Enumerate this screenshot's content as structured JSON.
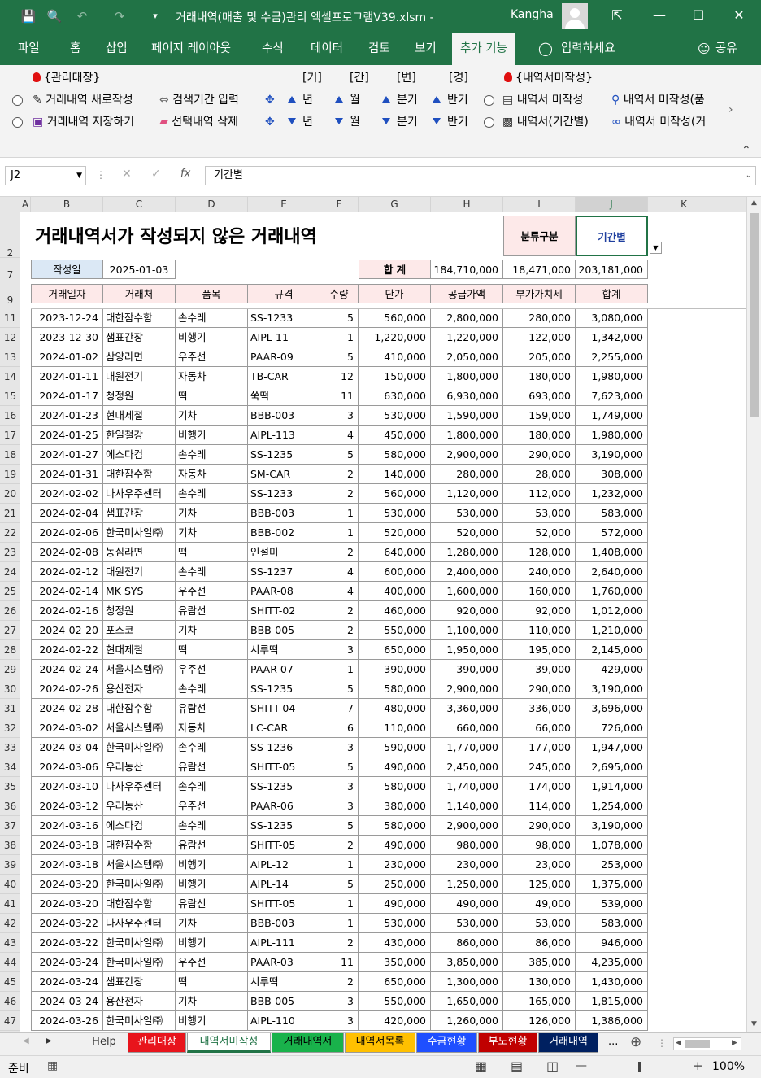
{
  "titlebar": {
    "doc_title": "거래내역(매출 및 수금)관리 엑셀프로그램V39.xlsm  -",
    "user": "Kangha"
  },
  "ribbon_tabs": [
    "파일",
    "홈",
    "삽입",
    "페이지 레이아웃",
    "수식",
    "데이터",
    "검토",
    "보기",
    "추가 기능"
  ],
  "tell_me": "입력하세요",
  "share": "공유",
  "ribbon": {
    "group1_label": "{관리대장}",
    "btn_new": "거래내역 새로작성",
    "btn_save": "거래내역 저장하기",
    "btn_period": "검색기간 입력",
    "btn_delete": "선택내역 삭제",
    "hdr_gi": "[기]",
    "hdr_gan": "[간]",
    "hdr_byeon": "[변]",
    "hdr_gyeong": "[경]",
    "year": "년",
    "month": "월",
    "quarter": "분기",
    "half": "반기",
    "group2_label": "{내역서미작성}",
    "btn_unwritten": "내역서 미작성",
    "btn_unwritten_period": "내역서(기간별)",
    "btn_unwritten_item": "내역서 미작성(품",
    "btn_unwritten_client": "내역서 미작성(거"
  },
  "formula_bar": {
    "name_box": "J2",
    "formula": "기간별"
  },
  "columns": [
    "A",
    "B",
    "C",
    "D",
    "E",
    "F",
    "G",
    "H",
    "I",
    "J",
    "K"
  ],
  "sheet": {
    "title": "거래내역서가 작성되지 않은 거래내역",
    "class_label": "분류구분",
    "class_value": "기간별",
    "date_label": "작성일",
    "date_value": "2025-01-03",
    "total_label": "합  계",
    "total_supply": "184,710,000",
    "total_vat": "18,471,000",
    "total_sum": "203,181,000",
    "headers": [
      "거래일자",
      "거래처",
      "품목",
      "규격",
      "수량",
      "단가",
      "공급가액",
      "부가가치세",
      "합계"
    ],
    "rows": [
      [
        "2023-12-24",
        "대한잠수함",
        "손수레",
        "SS-1233",
        "5",
        "560,000",
        "2,800,000",
        "280,000",
        "3,080,000"
      ],
      [
        "2023-12-30",
        "샘표간장",
        "비행기",
        "AIPL-11",
        "1",
        "1,220,000",
        "1,220,000",
        "122,000",
        "1,342,000"
      ],
      [
        "2024-01-02",
        "삼양라면",
        "우주선",
        "PAAR-09",
        "5",
        "410,000",
        "2,050,000",
        "205,000",
        "2,255,000"
      ],
      [
        "2024-01-11",
        "대원전기",
        "자동차",
        "TB-CAR",
        "12",
        "150,000",
        "1,800,000",
        "180,000",
        "1,980,000"
      ],
      [
        "2024-01-17",
        "청정원",
        "떡",
        "쑥떡",
        "11",
        "630,000",
        "6,930,000",
        "693,000",
        "7,623,000"
      ],
      [
        "2024-01-23",
        "현대제철",
        "기차",
        "BBB-003",
        "3",
        "530,000",
        "1,590,000",
        "159,000",
        "1,749,000"
      ],
      [
        "2024-01-25",
        "한일철강",
        "비행기",
        "AIPL-113",
        "4",
        "450,000",
        "1,800,000",
        "180,000",
        "1,980,000"
      ],
      [
        "2024-01-27",
        "에스다컴",
        "손수레",
        "SS-1235",
        "5",
        "580,000",
        "2,900,000",
        "290,000",
        "3,190,000"
      ],
      [
        "2024-01-31",
        "대한잠수함",
        "자동차",
        "SM-CAR",
        "2",
        "140,000",
        "280,000",
        "28,000",
        "308,000"
      ],
      [
        "2024-02-02",
        "나사우주센터",
        "손수레",
        "SS-1233",
        "2",
        "560,000",
        "1,120,000",
        "112,000",
        "1,232,000"
      ],
      [
        "2024-02-04",
        "샘표간장",
        "기차",
        "BBB-003",
        "1",
        "530,000",
        "530,000",
        "53,000",
        "583,000"
      ],
      [
        "2024-02-06",
        "한국미사일㈜",
        "기차",
        "BBB-002",
        "1",
        "520,000",
        "520,000",
        "52,000",
        "572,000"
      ],
      [
        "2024-02-08",
        "농심라면",
        "떡",
        "인절미",
        "2",
        "640,000",
        "1,280,000",
        "128,000",
        "1,408,000"
      ],
      [
        "2024-02-12",
        "대원전기",
        "손수레",
        "SS-1237",
        "4",
        "600,000",
        "2,400,000",
        "240,000",
        "2,640,000"
      ],
      [
        "2024-02-14",
        "MK SYS",
        "우주선",
        "PAAR-08",
        "4",
        "400,000",
        "1,600,000",
        "160,000",
        "1,760,000"
      ],
      [
        "2024-02-16",
        "청정원",
        "유람선",
        "SHITT-02",
        "2",
        "460,000",
        "920,000",
        "92,000",
        "1,012,000"
      ],
      [
        "2024-02-20",
        "포스코",
        "기차",
        "BBB-005",
        "2",
        "550,000",
        "1,100,000",
        "110,000",
        "1,210,000"
      ],
      [
        "2024-02-22",
        "현대제철",
        "떡",
        "시루떡",
        "3",
        "650,000",
        "1,950,000",
        "195,000",
        "2,145,000"
      ],
      [
        "2024-02-24",
        "서울시스템㈜",
        "우주선",
        "PAAR-07",
        "1",
        "390,000",
        "390,000",
        "39,000",
        "429,000"
      ],
      [
        "2024-02-26",
        "용산전자",
        "손수레",
        "SS-1235",
        "5",
        "580,000",
        "2,900,000",
        "290,000",
        "3,190,000"
      ],
      [
        "2024-02-28",
        "대한잠수함",
        "유람선",
        "SHITT-04",
        "7",
        "480,000",
        "3,360,000",
        "336,000",
        "3,696,000"
      ],
      [
        "2024-03-02",
        "서울시스템㈜",
        "자동차",
        "LC-CAR",
        "6",
        "110,000",
        "660,000",
        "66,000",
        "726,000"
      ],
      [
        "2024-03-04",
        "한국미사일㈜",
        "손수레",
        "SS-1236",
        "3",
        "590,000",
        "1,770,000",
        "177,000",
        "1,947,000"
      ],
      [
        "2024-03-06",
        "우리농산",
        "유람선",
        "SHITT-05",
        "5",
        "490,000",
        "2,450,000",
        "245,000",
        "2,695,000"
      ],
      [
        "2024-03-10",
        "나사우주센터",
        "손수레",
        "SS-1235",
        "3",
        "580,000",
        "1,740,000",
        "174,000",
        "1,914,000"
      ],
      [
        "2024-03-12",
        "우리농산",
        "우주선",
        "PAAR-06",
        "3",
        "380,000",
        "1,140,000",
        "114,000",
        "1,254,000"
      ],
      [
        "2024-03-16",
        "에스다컴",
        "손수레",
        "SS-1235",
        "5",
        "580,000",
        "2,900,000",
        "290,000",
        "3,190,000"
      ],
      [
        "2024-03-18",
        "대한잠수함",
        "유람선",
        "SHITT-05",
        "2",
        "490,000",
        "980,000",
        "98,000",
        "1,078,000"
      ],
      [
        "2024-03-18",
        "서울시스템㈜",
        "비행기",
        "AIPL-12",
        "1",
        "230,000",
        "230,000",
        "23,000",
        "253,000"
      ],
      [
        "2024-03-20",
        "한국미사일㈜",
        "비행기",
        "AIPL-14",
        "5",
        "250,000",
        "1,250,000",
        "125,000",
        "1,375,000"
      ],
      [
        "2024-03-20",
        "대한잠수함",
        "유람선",
        "SHITT-05",
        "1",
        "490,000",
        "490,000",
        "49,000",
        "539,000"
      ],
      [
        "2024-03-22",
        "나사우주센터",
        "기차",
        "BBB-003",
        "1",
        "530,000",
        "530,000",
        "53,000",
        "583,000"
      ],
      [
        "2024-03-22",
        "한국미사일㈜",
        "비행기",
        "AIPL-111",
        "2",
        "430,000",
        "860,000",
        "86,000",
        "946,000"
      ],
      [
        "2024-03-24",
        "한국미사일㈜",
        "우주선",
        "PAAR-03",
        "11",
        "350,000",
        "3,850,000",
        "385,000",
        "4,235,000"
      ],
      [
        "2024-03-24",
        "샘표간장",
        "떡",
        "시루떡",
        "2",
        "650,000",
        "1,300,000",
        "130,000",
        "1,430,000"
      ],
      [
        "2024-03-24",
        "용산전자",
        "기차",
        "BBB-005",
        "3",
        "550,000",
        "1,650,000",
        "165,000",
        "1,815,000"
      ],
      [
        "2024-03-26",
        "한국미사일㈜",
        "비행기",
        "AIPL-110",
        "3",
        "420,000",
        "1,260,000",
        "126,000",
        "1,386,000"
      ]
    ]
  },
  "row_numbers": [
    "2",
    "7",
    "9",
    "11",
    "12",
    "13",
    "14",
    "15",
    "16",
    "17",
    "18",
    "19",
    "20",
    "21",
    "22",
    "23",
    "24",
    "25",
    "26",
    "27",
    "28",
    "29",
    "30",
    "31",
    "32",
    "33",
    "34",
    "35",
    "36",
    "37",
    "38",
    "39",
    "40",
    "41",
    "42",
    "43",
    "44",
    "45",
    "46",
    "47"
  ],
  "sheet_tabs": [
    {
      "label": "Help",
      "bg": "#f0f0f0",
      "fg": "#333333"
    },
    {
      "label": "관리대장",
      "bg": "#e8141c",
      "fg": "#ffffff"
    },
    {
      "label": "내역서미작성",
      "bg": "#ffffff",
      "fg": "#217346"
    },
    {
      "label": "거래내역서",
      "bg": "#19b24b",
      "fg": "#000000"
    },
    {
      "label": "내역서목록",
      "bg": "#ffc000",
      "fg": "#000000"
    },
    {
      "label": "수금현황",
      "bg": "#1f4fff",
      "fg": "#ffffff"
    },
    {
      "label": "부도현황",
      "bg": "#c00000",
      "fg": "#ffffff"
    },
    {
      "label": "거래내역",
      "bg": "#002060",
      "fg": "#ffffff"
    }
  ],
  "more_tabs": "...",
  "status": {
    "ready": "준비",
    "zoom": "100%"
  },
  "colors": {
    "excel_green": "#217346",
    "header_fill": "#fde9e9",
    "label_fill": "#dbe8f5"
  }
}
